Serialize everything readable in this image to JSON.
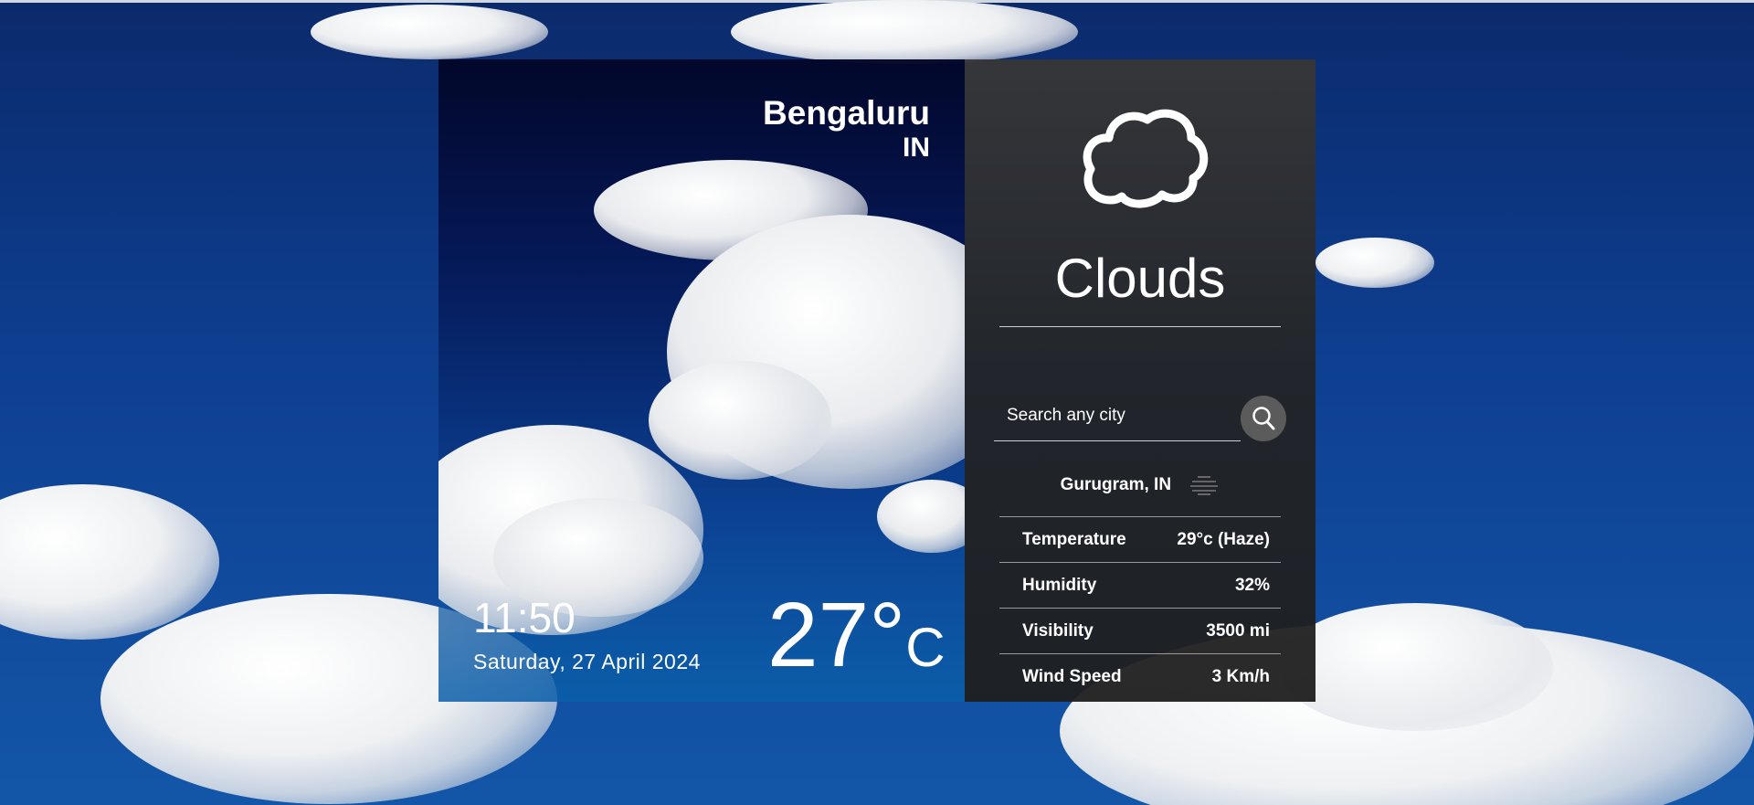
{
  "location": {
    "city": "Bengaluru",
    "country": "IN"
  },
  "clock": {
    "time": "11:50",
    "date": "Saturday, 27 April 2024"
  },
  "current": {
    "temperature": "27°",
    "unit": "C"
  },
  "condition": {
    "label": "Clouds",
    "icon": "cloud-icon"
  },
  "search": {
    "placeholder": "Search any city",
    "button_icon": "search-icon"
  },
  "searched_city": {
    "name": "Gurugram, IN",
    "icon": "haze-icon",
    "details": [
      {
        "label": "Temperature",
        "value": "29°c (Haze)"
      },
      {
        "label": "Humidity",
        "value": "32%"
      },
      {
        "label": "Visibility",
        "value": "3500 mi"
      },
      {
        "label": "Wind Speed",
        "value": "3 Km/h"
      }
    ]
  },
  "colors": {
    "sky": "#0e3f91",
    "panel_dark": "#2a2a2a",
    "text": "#ffffff"
  }
}
